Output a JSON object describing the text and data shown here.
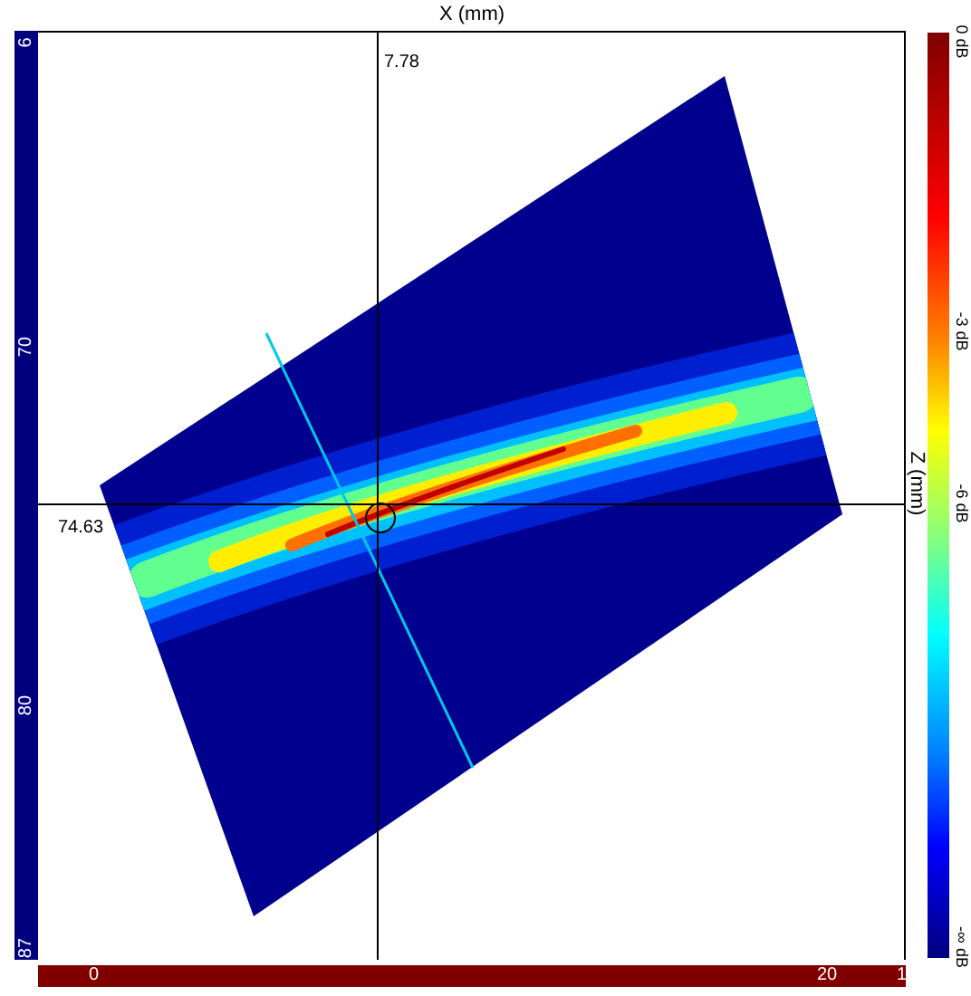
{
  "axes": {
    "x_title": "X (mm)",
    "z_title": "Z (mm)"
  },
  "cursor": {
    "x_readout": "7.78",
    "z_readout": "74.63"
  },
  "left_ruler": {
    "labels": [
      "6",
      "70",
      "80",
      "87"
    ]
  },
  "bottom_ruler": {
    "labels": [
      "0",
      "20",
      "1"
    ]
  },
  "colorbar": {
    "labels": [
      "0 dB",
      "-3 dB",
      "-6 dB",
      "-∞ dB"
    ]
  }
}
